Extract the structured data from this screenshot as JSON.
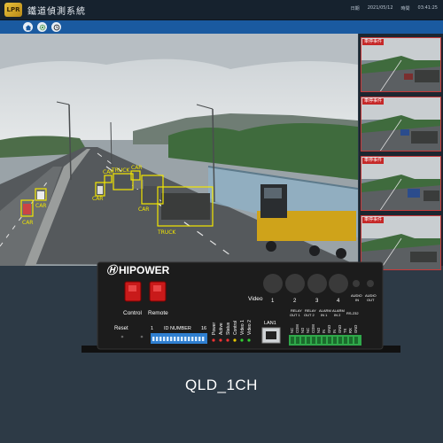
{
  "header": {
    "logo_text": "LPR",
    "app_title": "鐵道偵測系統",
    "date_label": "日期",
    "date_value": "2021/05/12",
    "time_label": "時間",
    "time_value": "03:41:25"
  },
  "toolbar": {
    "buttons": [
      {
        "icon": "home-icon"
      },
      {
        "icon": "gear-icon"
      },
      {
        "icon": "clock-icon"
      }
    ]
  },
  "main_camera": {
    "detection_labels": [
      "CAR",
      "CAR",
      "CAR",
      "TRUCK",
      "CAR",
      "CAR",
      "TRUCK",
      "CAR"
    ],
    "box_color": "#f2e600"
  },
  "thumbnails": [
    {
      "tag": "車停事件"
    },
    {
      "tag": "車停事件"
    },
    {
      "tag": "車停事件"
    },
    {
      "tag": "車停事件"
    }
  ],
  "device": {
    "brand": "HIPOWER",
    "video_label": "Video",
    "video_ports": [
      "1",
      "2",
      "3",
      "4"
    ],
    "audio_in": "AUDIO\nIN",
    "audio_out": "AUDIO\nOUT",
    "control_label": "Control",
    "remote_label": "Remote",
    "reset_label": "Reset",
    "id_number_left": "1",
    "id_number_label": "ID NUMBER",
    "id_number_right": "16",
    "led_labels": [
      "Power",
      "Active",
      "Status",
      "Control",
      "Video 1",
      "Video 2"
    ],
    "lan_label": "LAN1",
    "terminal_headers": [
      "RELAY OUT 1",
      "RELAY OUT 2",
      "ALARM IN 1",
      "ALARM IN 2",
      "RS-232"
    ],
    "pin_labels": [
      "NC",
      "COM",
      "NO",
      "NC",
      "COM",
      "NO",
      "IN",
      "GND",
      "IN",
      "GND",
      "TX",
      "RX",
      "GND"
    ]
  },
  "product": {
    "name": "QLD_1CH"
  }
}
